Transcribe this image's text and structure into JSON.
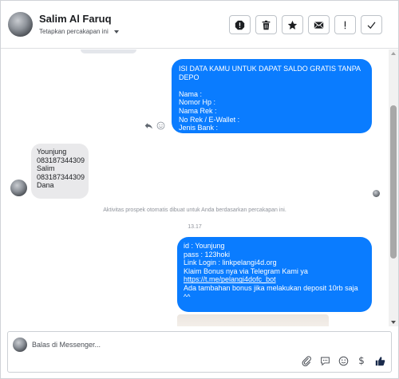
{
  "header": {
    "contact_name": "Salim Al Faruq",
    "subtitle": "Tetapkan percakapan ini",
    "toolbar": [
      {
        "name": "spam-icon",
        "title": "Spam"
      },
      {
        "name": "trash-icon",
        "title": "Hapus"
      },
      {
        "name": "star-icon",
        "title": "Bintangi"
      },
      {
        "name": "mark-unread-icon",
        "title": "Tandai belum dibaca"
      },
      {
        "name": "follow-up-icon",
        "title": "Tindak lanjut"
      },
      {
        "name": "done-icon",
        "title": "Selesai"
      }
    ]
  },
  "messages": {
    "outgoing_1": "ISI DATA KAMU UNTUK DAPAT SALDO GRATIS TANPA DEPO\n\nNama :\nNomor Hp :\nNama Rek :\nNo Rek / E-Wallet :\nJenis Bank :",
    "incoming_1": "Younjung\n083187344309\nSalim\n083187344309\nDana",
    "system_note": "Aktivitas prospek otomatis dibuat untuk Anda berdasarkan percakapan ini.",
    "timestamp": "13.17",
    "outgoing_2": {
      "text": "id : Younjung\npass : 123hoki\nLink Login : linkpelangi4d.org\nKlaim Bonus nya via Telegram Kami ya\n",
      "link": "https://t.me/pelangi4dofc_bot",
      "footer": "\nAda tambahan bonus jika melakukan deposit 10rb saja ^^"
    }
  },
  "composer": {
    "placeholder": "Balas di Messenger...",
    "actions": [
      "attach-icon",
      "saved-replies-icon",
      "emoji-icon",
      "payment-icon",
      "like-icon"
    ]
  },
  "colors": {
    "accent": "#0a7cff",
    "incoming_bubble": "#e9e9eb",
    "like": "#0a7cff"
  }
}
